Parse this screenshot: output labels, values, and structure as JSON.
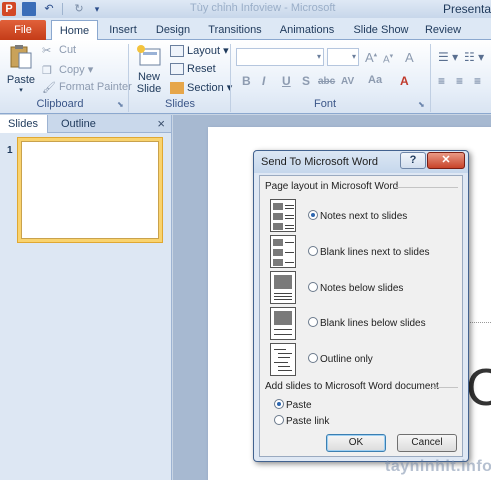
{
  "title_bar": {
    "app_title": "Presenta",
    "faded_text": "Tùy chỉnh Infoview - Microsoft"
  },
  "ribbon_tabs": [
    "File",
    "Home",
    "Insert",
    "Design",
    "Transitions",
    "Animations",
    "Slide Show",
    "Review"
  ],
  "clipboard": {
    "paste": "Paste",
    "cut": "Cut",
    "copy": "Copy",
    "format_painter": "Format Painter",
    "group": "Clipboard"
  },
  "slides_group": {
    "new_slide_line1": "New",
    "new_slide_line2": "Slide",
    "layout": "Layout",
    "reset": "Reset",
    "section": "Section",
    "group": "Slides"
  },
  "font_group": {
    "bold": "B",
    "italic": "I",
    "underline": "U",
    "shadow": "S",
    "strike": "abc",
    "spacing": "AV",
    "case": "Aa",
    "grow": "A",
    "shrink": "A",
    "clear": "A",
    "color": "A",
    "group": "Font"
  },
  "pane": {
    "tab_slides": "Slides",
    "tab_outline": "Outline",
    "close": "×",
    "slide_number": "1"
  },
  "editor": {
    "visible_text": "C"
  },
  "dialog": {
    "title": "Send To Microsoft Word",
    "help": "?",
    "close": "✕",
    "layout_section": "Page layout in Microsoft Word",
    "options": [
      {
        "label": "Notes next to slides",
        "selected": true
      },
      {
        "label": "Blank lines next to slides",
        "selected": false
      },
      {
        "label": "Notes below slides",
        "selected": false
      },
      {
        "label": "Blank lines below slides",
        "selected": false
      },
      {
        "label": "Outline only",
        "selected": false
      }
    ],
    "add_section": "Add slides to Microsoft Word document",
    "paste_options": [
      {
        "label": "Paste",
        "selected": true
      },
      {
        "label": "Paste link",
        "selected": false
      }
    ],
    "ok": "OK",
    "cancel": "Cancel"
  },
  "watermark": "tayninhit.info",
  "colors": {
    "file_tab": "#d24726",
    "ribbon_text": "#1e395b",
    "dialog_body": "#f0f0f0",
    "radio_selected": "#2d67b0"
  }
}
